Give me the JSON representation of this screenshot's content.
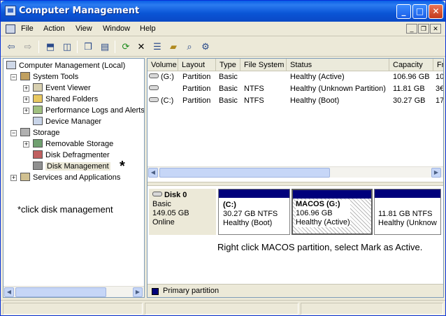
{
  "window": {
    "title": "Computer Management"
  },
  "menubar": {
    "items": [
      "File",
      "Action",
      "View",
      "Window",
      "Help"
    ]
  },
  "tree": {
    "root": "Computer Management (Local)",
    "system_tools": "System Tools",
    "event_viewer": "Event Viewer",
    "shared_folders": "Shared Folders",
    "perf_logs": "Performance Logs and Alerts",
    "device_manager": "Device Manager",
    "storage": "Storage",
    "removable_storage": "Removable Storage",
    "disk_defrag": "Disk Defragmenter",
    "disk_management": "Disk Management",
    "services_apps": "Services and Applications"
  },
  "annotations": {
    "asterisk": "*",
    "left_note": "*click disk management",
    "right_note": "Right click MACOS partition, select Mark as Active."
  },
  "volume_table": {
    "columns": [
      "Volume",
      "Layout",
      "Type",
      "File System",
      "Status",
      "Capacity",
      "Fr"
    ],
    "rows": [
      {
        "volume": "(G:)",
        "layout": "Partition",
        "type": "Basic",
        "fs": "",
        "status": "Healthy (Active)",
        "capacity": "106.96 GB",
        "free": "10"
      },
      {
        "volume": "",
        "layout": "Partition",
        "type": "Basic",
        "fs": "NTFS",
        "status": "Healthy (Unknown Partition)",
        "capacity": "11.81 GB",
        "free": "3€"
      },
      {
        "volume": "(C:)",
        "layout": "Partition",
        "type": "Basic",
        "fs": "NTFS",
        "status": "Healthy (Boot)",
        "capacity": "30.27 GB",
        "free": "17"
      }
    ]
  },
  "disk": {
    "name": "Disk 0",
    "type": "Basic",
    "size": "149.05 GB",
    "status": "Online",
    "partitions": [
      {
        "title": "(C:)",
        "line2": "30.27 GB NTFS",
        "line3": "Healthy (Boot)"
      },
      {
        "title": "MACOS  (G:)",
        "line2": "106.96 GB",
        "line3": "Healthy (Active)"
      },
      {
        "title": "",
        "line2": "11.81 GB NTFS",
        "line3": "Healthy (Unknow"
      }
    ]
  },
  "legend": {
    "primary": "Primary partition"
  },
  "colors": {
    "titlebar": "#0a55d6",
    "partition_bar": "#00007b"
  }
}
